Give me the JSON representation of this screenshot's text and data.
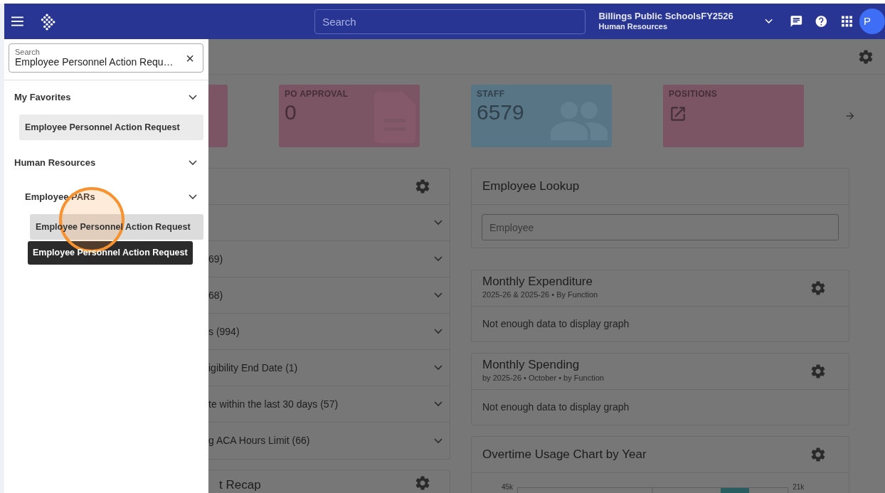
{
  "topbar": {
    "search_placeholder": "Search",
    "org": "Billings Public SchoolsFY2526",
    "module": "Human Resources",
    "avatar": "P"
  },
  "sidebar": {
    "search": {
      "label": "Search",
      "value": "Employee Personnel Action Requ…",
      "clear": "×"
    },
    "groups": [
      {
        "label": "My Favorites",
        "expanded": true,
        "children": [
          {
            "label": "Employee Personnel Action Request",
            "hovered": false
          }
        ]
      },
      {
        "label": "Human Resources",
        "expanded": true,
        "children": [
          {
            "label": "Employee PARs",
            "expanded": true,
            "children": [
              {
                "label": "Employee Personnel Action Request",
                "hovered": true
              }
            ]
          }
        ]
      }
    ],
    "tooltip": "Employee Personnel Action Request"
  },
  "cursor_highlight": true,
  "tiles": [
    {
      "kind": "cut",
      "color": "#7b5563"
    },
    {
      "kind": "document",
      "color": "#7b5563",
      "label": "PO APPROVAL",
      "value": "0"
    },
    {
      "kind": "people",
      "color": "#587586",
      "label": "STAFF",
      "value": "6579"
    },
    {
      "kind": "link",
      "color": "#7b5563",
      "label": "POSITIONS"
    }
  ],
  "left_card": {
    "rows": [
      {
        "expanded": false
      },
      {
        "text": "69)",
        "expanded": false
      },
      {
        "text": "68)",
        "expanded": false
      },
      {
        "text": "s (994)",
        "expanded": false
      },
      {
        "text": "igibility End Date (1)",
        "expanded": false
      },
      {
        "text": "te within the last 30 days (57)",
        "expanded": false
      },
      {
        "text": "g ACA Hours Limit (66)",
        "expanded": false
      }
    ],
    "next_title": "t Recap"
  },
  "right_cards": [
    {
      "kind": "lookup",
      "title": "Employee Lookup",
      "placeholder": "Employee"
    },
    {
      "kind": "graph",
      "title": "Monthly Expenditure",
      "subtitle": "2025-26 & 2025-26 • By Function",
      "message": "Not enough data to display graph"
    },
    {
      "kind": "graph",
      "title": "Monthly Spending",
      "subtitle": "by 2025-26 • October • by Function",
      "message": "Not enough data to display graph"
    },
    {
      "kind": "chart",
      "title": "Overtime Usage Chart by Year",
      "left_tick": "45k",
      "right_tick": "21k"
    }
  ]
}
